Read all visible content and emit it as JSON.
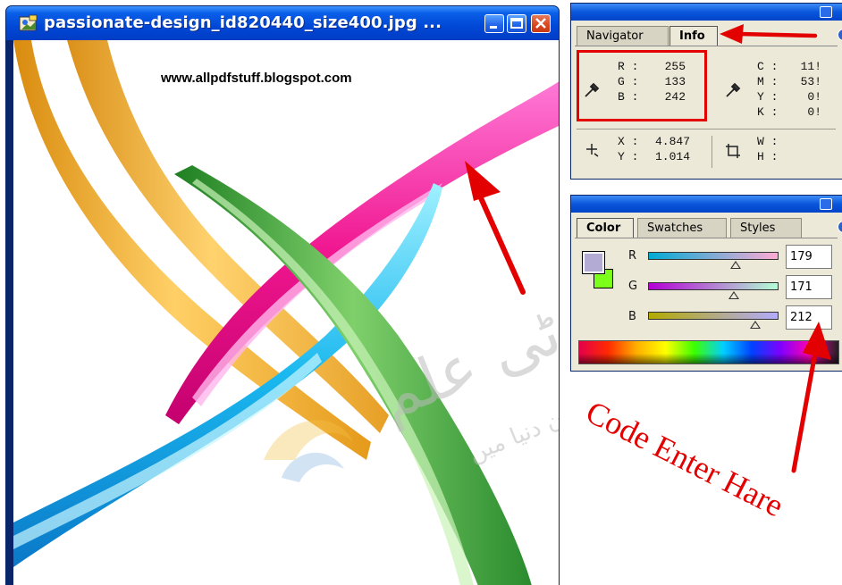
{
  "document": {
    "title": "passionate-design_id820440_size400.jpg ...",
    "watermark_url": "www.allpdfstuff.blogspot.com",
    "watermark_urdu_main": "آئی ٹی علم",
    "watermark_urdu_sub": "پہچان دنیا میں"
  },
  "info_panel": {
    "tabs": [
      "Navigator",
      "Info"
    ],
    "active_tab": "Info",
    "rgb": {
      "R": "255",
      "G": "133",
      "B": "242"
    },
    "rgb_labels": {
      "R": "R :",
      "G": "G :",
      "B": "B :"
    },
    "cmyk": {
      "C": "11!",
      "M": "53!",
      "Y": "0!",
      "K": "0!"
    },
    "cmyk_labels": {
      "C": "C :",
      "M": "M :",
      "Y": "Y :",
      "K": "K :"
    },
    "xy": {
      "X": "4.847",
      "Y": "1.014"
    },
    "xy_labels": {
      "X": "X :",
      "Y": "Y :"
    },
    "wh_labels": {
      "W": "W :",
      "H": "H :"
    }
  },
  "color_panel": {
    "tabs": [
      "Color",
      "Swatches",
      "Styles"
    ],
    "active_tab": "Color",
    "sliders": {
      "R": {
        "label": "R",
        "value": "179"
      },
      "G": {
        "label": "G",
        "value": "171"
      },
      "B": {
        "label": "B",
        "value": "212"
      }
    },
    "foreground_color": "#b3abd4",
    "background_color": "#7dff1c"
  },
  "annotation": {
    "text": "Code Enter Hare",
    "color": "#e30000"
  },
  "icons": [
    "document-icon",
    "minimize-icon",
    "maximize-icon",
    "close-icon",
    "eyedropper-icon",
    "crosshair-icon",
    "selection-size-icon",
    "arrow-annotation-icon"
  ]
}
